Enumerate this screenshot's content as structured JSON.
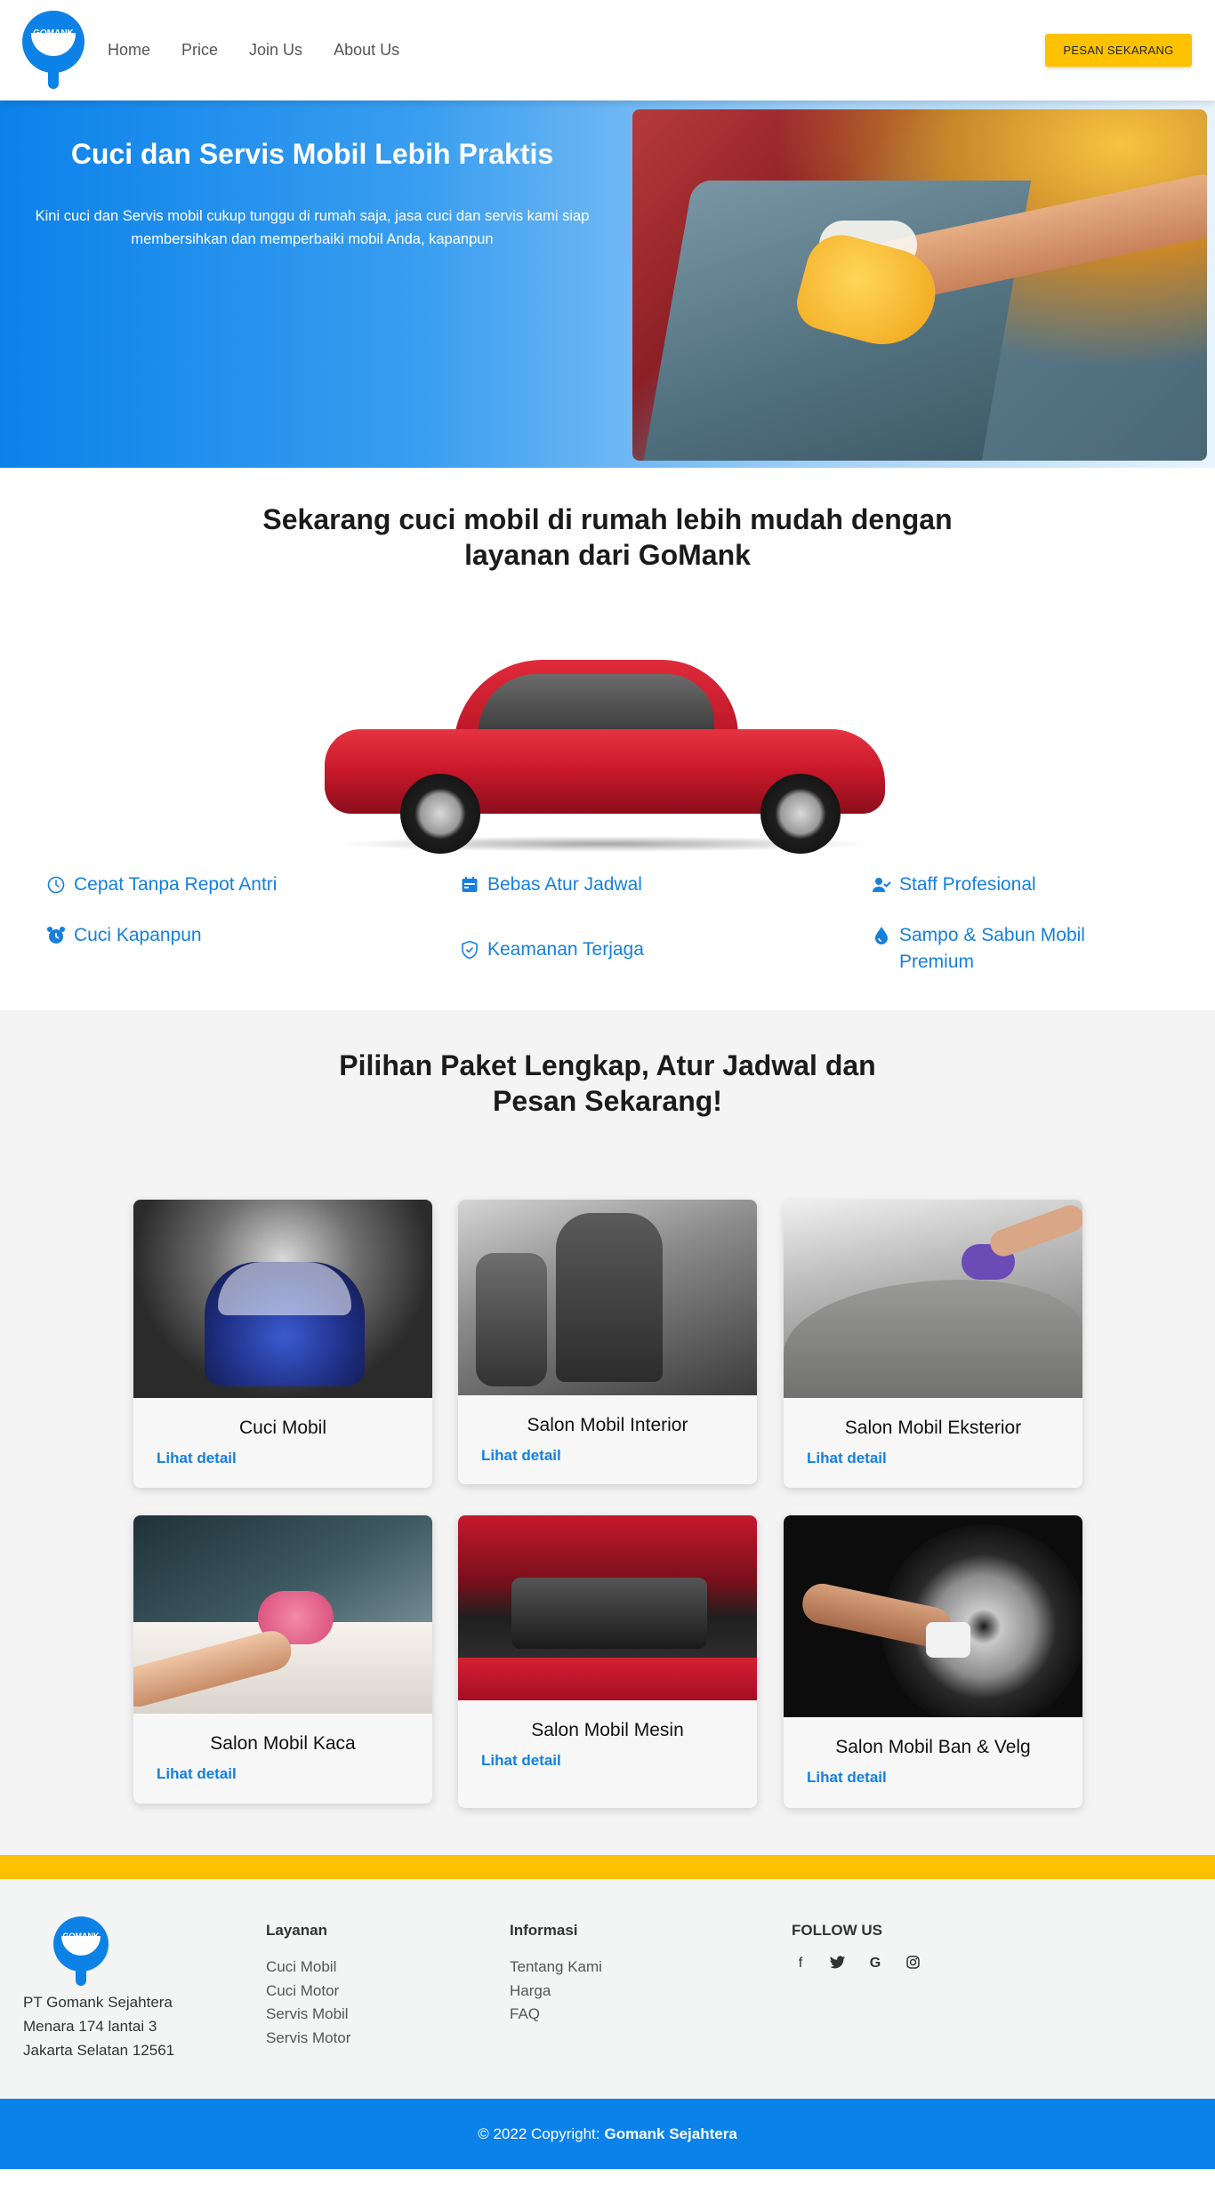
{
  "nav": {
    "logo_text": "GOMANK",
    "links": [
      "Home",
      "Price",
      "Join Us",
      "About Us"
    ],
    "cta": "PESAN SEKARANG"
  },
  "hero": {
    "title": "Cuci dan Servis Mobil Lebih Praktis",
    "text": "Kini cuci dan Servis mobil cukup tunggu di rumah saja, jasa cuci dan servis kami siap membersihkan dan memperbaiki mobil Anda, kapanpun"
  },
  "intro": {
    "title": "Sekarang cuci mobil di rumah lebih mudah dengan layanan dari GoMank"
  },
  "features": [
    {
      "label": "Cepat Tanpa Repot Antri",
      "icon": "clock-icon"
    },
    {
      "label": "Bebas Atur Jadwal",
      "icon": "calendar-icon"
    },
    {
      "label": "Staff Profesional",
      "icon": "user-check-icon"
    },
    {
      "label": "Cuci Kapanpun",
      "icon": "alarm-clock-icon"
    },
    {
      "label": "Keamanan Terjaga",
      "icon": "shield-check-icon"
    },
    {
      "label": "Sampo & Sabun Mobil Premium",
      "icon": "droplet-icon"
    }
  ],
  "packages": {
    "title": "Pilihan Paket Lengkap, Atur Jadwal dan Pesan Sekarang!",
    "detail_label": "Lihat detail",
    "cards": [
      {
        "title": "Cuci Mobil"
      },
      {
        "title": "Salon Mobil Interior"
      },
      {
        "title": "Salon Mobil Eksterior"
      },
      {
        "title": "Salon Mobil Kaca"
      },
      {
        "title": "Salon Mobil Mesin"
      },
      {
        "title": "Salon Mobil Ban & Velg"
      }
    ]
  },
  "footer": {
    "logo_text": "GOMANK",
    "address": [
      "PT Gomank Sejahtera",
      "Menara 174 lantai 3",
      "Jakarta Selatan 12561"
    ],
    "layanan": {
      "title": "Layanan",
      "items": [
        "Cuci Mobil",
        "Cuci Motor",
        "Servis Mobil",
        "Servis Motor"
      ]
    },
    "informasi": {
      "title": "Informasi",
      "items": [
        "Tentang Kami",
        "Harga",
        "FAQ"
      ]
    },
    "follow": {
      "title": "FOLLOW US",
      "icons": [
        "facebook-icon",
        "twitter-icon",
        "google-icon",
        "instagram-icon"
      ]
    },
    "copyright_prefix": "© 2022 Copyright:",
    "copyright_name": "Gomank Sejahtera"
  },
  "colors": {
    "primary": "#0b82ea",
    "accent": "#fcc200",
    "link": "#1580df"
  }
}
